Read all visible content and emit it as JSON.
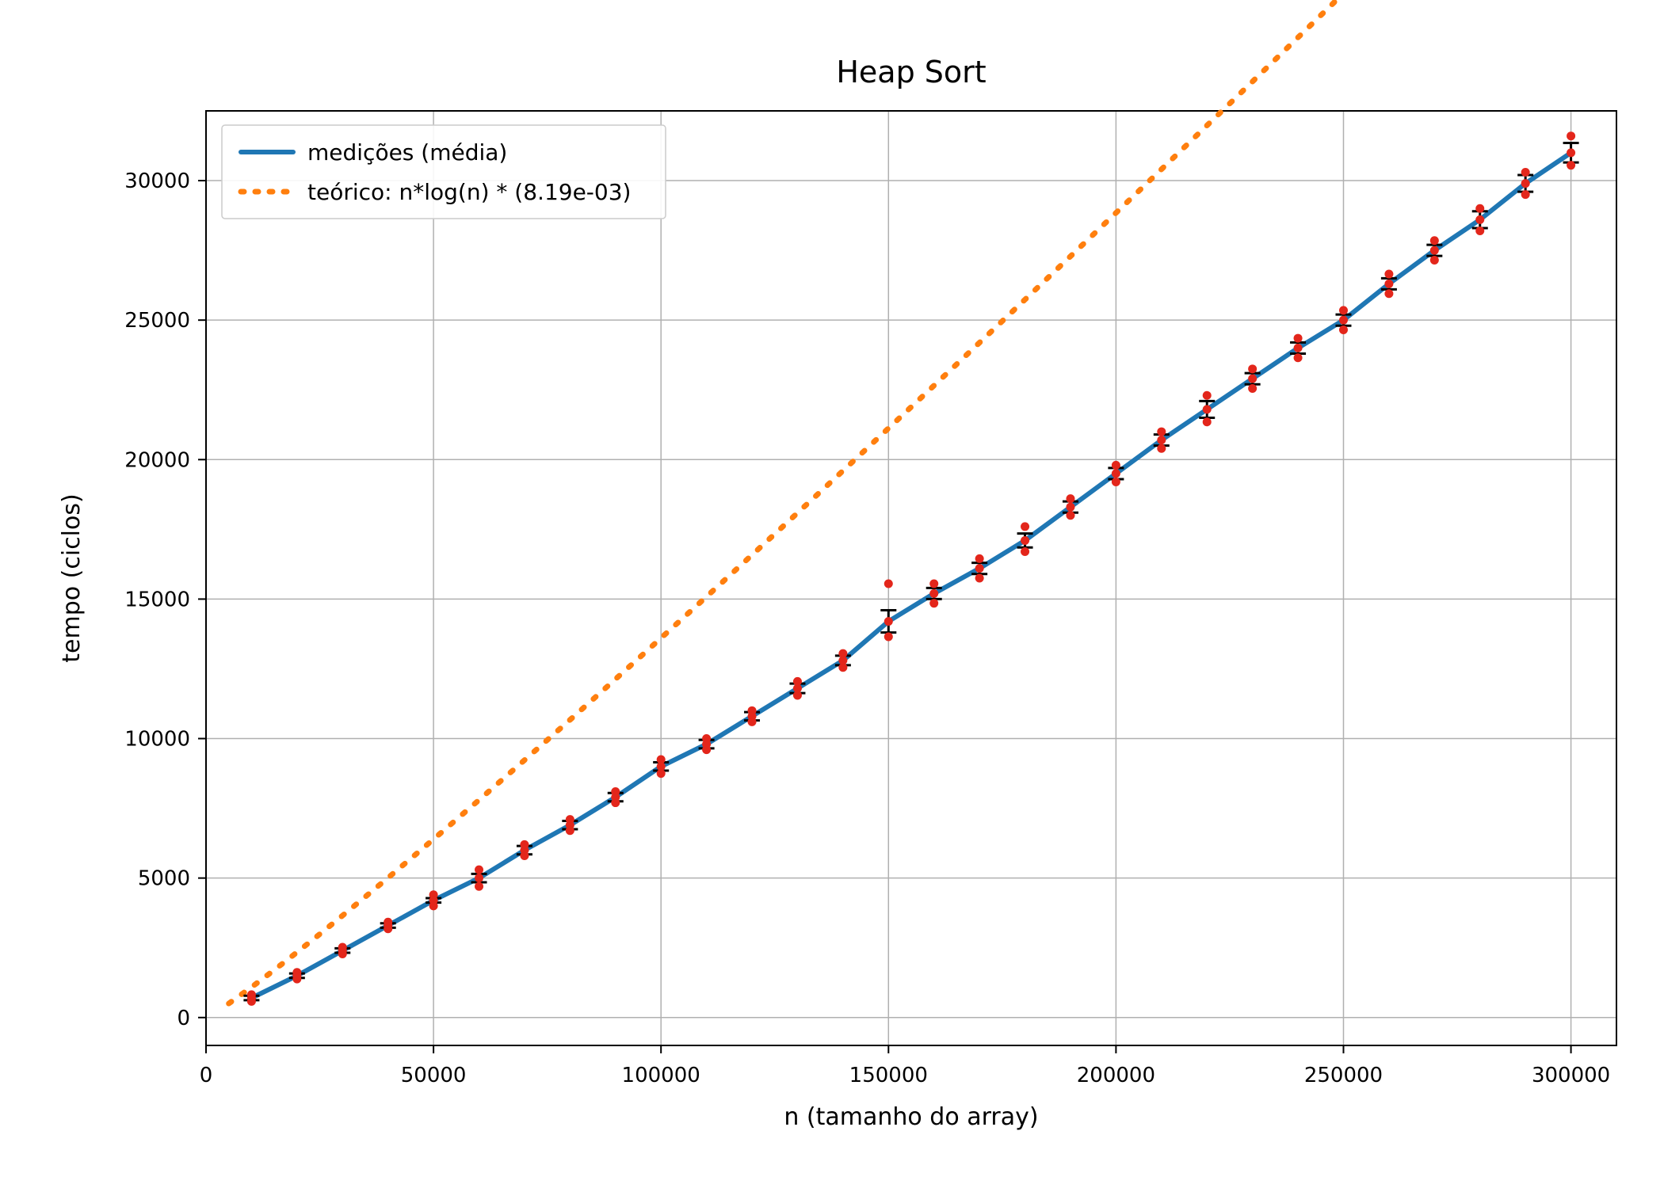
{
  "chart_data": {
    "type": "line",
    "title": "Heap Sort",
    "xlabel": "n (tamanho do array)",
    "ylabel": "tempo (ciclos)",
    "xlim": [
      0,
      310000
    ],
    "ylim": [
      -1000,
      32500
    ],
    "xticks": [
      0,
      50000,
      100000,
      150000,
      200000,
      250000,
      300000
    ],
    "yticks": [
      0,
      5000,
      10000,
      15000,
      20000,
      25000,
      30000
    ],
    "series": [
      {
        "name": "medições (média)",
        "kind": "measured",
        "x": [
          10000,
          20000,
          30000,
          40000,
          50000,
          60000,
          70000,
          80000,
          90000,
          100000,
          110000,
          120000,
          130000,
          140000,
          150000,
          160000,
          170000,
          180000,
          190000,
          200000,
          210000,
          220000,
          230000,
          240000,
          250000,
          260000,
          270000,
          280000,
          290000,
          300000
        ],
        "y": [
          700,
          1500,
          2400,
          3300,
          4200,
          5000,
          6000,
          6900,
          7900,
          9000,
          9800,
          10800,
          11800,
          12800,
          14200,
          15200,
          16100,
          17100,
          18300,
          19500,
          20700,
          21800,
          22900,
          24000,
          25000,
          26300,
          27500,
          28600,
          29900,
          31000
        ],
        "err": [
          80,
          80,
          80,
          80,
          80,
          150,
          150,
          150,
          150,
          150,
          150,
          150,
          170,
          170,
          400,
          200,
          200,
          250,
          200,
          200,
          200,
          300,
          200,
          200,
          200,
          200,
          200,
          300,
          300,
          350
        ],
        "scatter_offsets": [
          [
            -120,
            120
          ],
          [
            -120,
            120
          ],
          [
            -120,
            120
          ],
          [
            -120,
            120
          ],
          [
            -200,
            200
          ],
          [
            -300,
            300
          ],
          [
            -200,
            200
          ],
          [
            -200,
            200
          ],
          [
            -200,
            200
          ],
          [
            -250,
            250
          ],
          [
            -200,
            200
          ],
          [
            -200,
            200
          ],
          [
            -250,
            250
          ],
          [
            -250,
            250
          ],
          [
            -550,
            1350
          ],
          [
            -350,
            350
          ],
          [
            -350,
            350
          ],
          [
            -400,
            500
          ],
          [
            -300,
            300
          ],
          [
            -300,
            300
          ],
          [
            -300,
            300
          ],
          [
            -450,
            500
          ],
          [
            -350,
            350
          ],
          [
            -350,
            350
          ],
          [
            -350,
            350
          ],
          [
            -350,
            350
          ],
          [
            -350,
            350
          ],
          [
            -400,
            400
          ],
          [
            -400,
            400
          ],
          [
            -450,
            600
          ]
        ]
      },
      {
        "name": "teórico: n*log(n) * (8.19e-03)",
        "kind": "theory",
        "constant": 0.00819
      }
    ],
    "legend_position": "upper-left",
    "grid": true,
    "colors": {
      "measured_line": "#1f77b4",
      "theory_line": "#ff7f0e",
      "scatter": "#e3261b",
      "errorbar": "#000000",
      "grid": "#b0b0b0",
      "spine": "#000000"
    }
  }
}
